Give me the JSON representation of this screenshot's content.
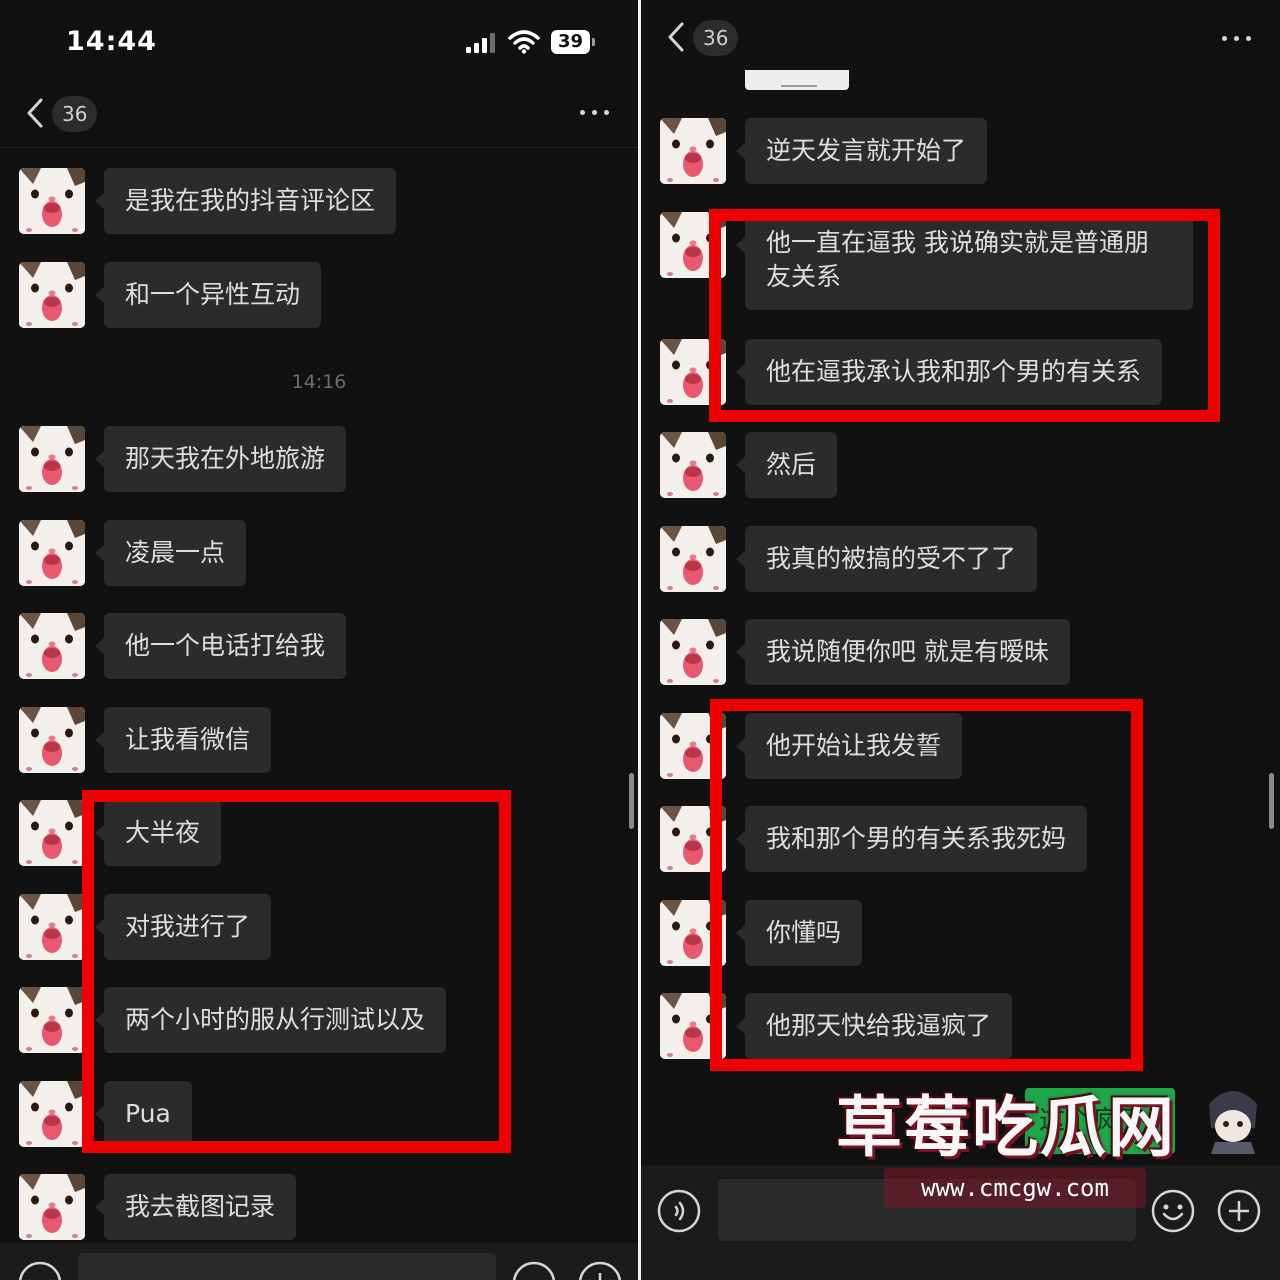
{
  "left_screen": {
    "status_bar": {
      "time": "14:44",
      "battery_level": "39"
    },
    "header": {
      "unread_count": "36"
    },
    "time_separator": "14:16",
    "messages": [
      "是我在我的抖音评论区",
      "和一个异性互动",
      "那天我在外地旅游",
      "凌晨一点",
      "他一个电话打给我",
      "让我看微信",
      "大半夜",
      "对我进行了",
      "两个小时的服从行测试以及",
      "Pua",
      "我去截图记录"
    ]
  },
  "right_screen": {
    "header": {
      "unread_count": "36"
    },
    "messages": [
      "逆天发言就开始了",
      "他一直在逼我 我说确实就是普通朋友关系",
      "他在逼我承认我和那个男的有关系",
      "然后",
      "我真的被搞的受不了了",
      "我说随便你吧 就是有暧昧",
      "他开始让我发誓",
      "我和那个男的有关系我死妈",
      "你懂吗",
      "他那天快给我逼疯了"
    ]
  },
  "watermark": {
    "title": "草莓吃瓜网",
    "url": "www.cmcgw.com",
    "sticker_text": "这个疯子"
  },
  "colors": {
    "background": "#111111",
    "bubble": "#2b2b2b",
    "highlight": "#ef0000",
    "input_bar": "#1b1b1b"
  },
  "icons": [
    "back-icon",
    "more-icon",
    "signal-icon",
    "wifi-icon",
    "battery-icon",
    "voice-icon",
    "emoji-icon",
    "plus-icon",
    "cat-avatar"
  ]
}
